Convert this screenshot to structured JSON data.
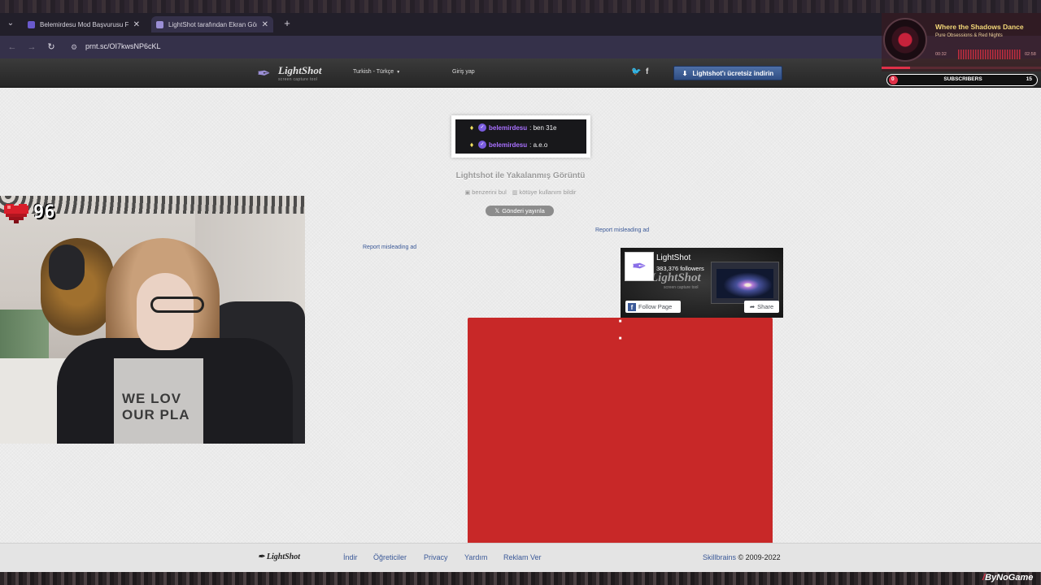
{
  "browser": {
    "tabs": [
      {
        "label": "Belemirdesu Mod Başvurusu Fo",
        "active": false,
        "favicon_color": "#6a5acd"
      },
      {
        "label": "LightShot tarafından Ekran Gör",
        "active": true,
        "favicon_color": "#9b8fd6"
      }
    ],
    "close_glyph": "✕",
    "new_tab_glyph": "+",
    "tab_menu_glyph": "⌄",
    "url": "prnt.sc/OI7kwsNP6cKL"
  },
  "lightshot_header": {
    "logo_name": "LightShot",
    "logo_sub": "screen capture tool",
    "language": "Turkish - Türkçe",
    "login": "Giriş yap",
    "download_button": "Lightshot'ı ücretsiz indirin"
  },
  "music_widget": {
    "song": "Where the Shadows Dance",
    "artist": "Pure Obsessions & Red Nights",
    "time_current": "00:32",
    "time_total": "02:58",
    "progress": 0.18
  },
  "subscribers": {
    "current": "0",
    "label": "SUBSCRIBERS",
    "goal": "15"
  },
  "screenshot": {
    "messages": [
      {
        "user": "belemirdesu",
        "text": ": ben 31e"
      },
      {
        "user": "belemirdesu",
        "text": ": a.e.o"
      }
    ]
  },
  "content": {
    "title": "Lightshot ile Yakalanmış Görüntü",
    "find_similar": "benzerini bul",
    "report_abuse": "kötüye kullanım bildir",
    "tweet_button": "Gönderi yayınla",
    "report_ad_1": "Report misleading ad",
    "report_ad_2": "Report misleading ad"
  },
  "facebook_widget": {
    "name": "LightShot",
    "followers": "383,376 followers",
    "watermark": "LightShot",
    "watermark_sub": "screen capture tool",
    "follow": "Follow Page",
    "share": "Share"
  },
  "webcam": {
    "hp": "96",
    "shirt_text_1": "WE LOV",
    "shirt_text_2": "OUR PLA"
  },
  "footer": {
    "logo": "LightShot",
    "links": [
      "İndir",
      "Öğreticiler",
      "Privacy",
      "Yardım",
      "Reklam Ver"
    ],
    "company": "Skillbrains",
    "copyright": " © 2009-2022"
  },
  "watermark": {
    "brand": "ByNoGame"
  }
}
